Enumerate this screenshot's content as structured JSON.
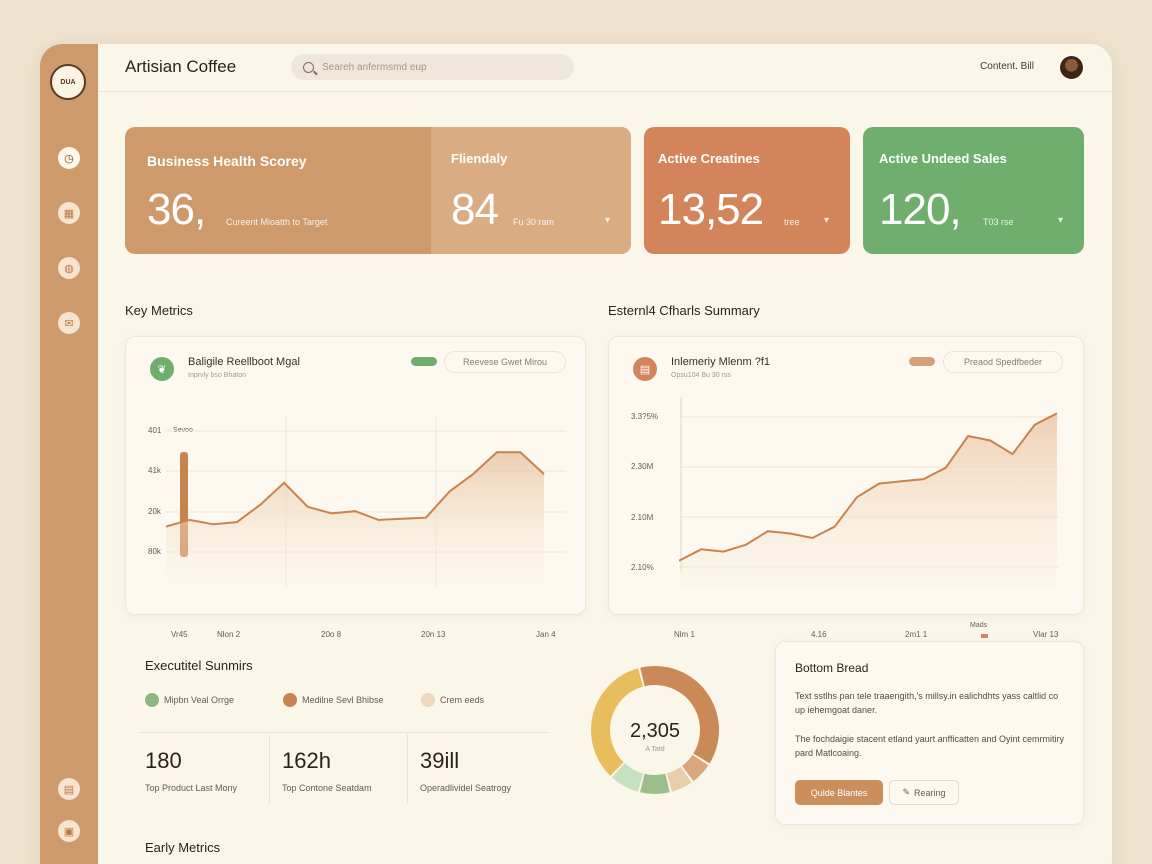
{
  "app": {
    "brand": "Artisian Coffee",
    "logo_text": "DUA",
    "search_placeholder": "Seareh anfermsmd eup",
    "user_name": "Content. Bill"
  },
  "colors": {
    "sidebar": "#cf9a6b",
    "kpi_brown": "#cf9a6b",
    "kpi_orange": "#d4845a",
    "kpi_green": "#6fae6c",
    "chart_line": "#c9834f"
  },
  "sidebar": {
    "icons": [
      "compass-icon",
      "store-icon",
      "cup-icon",
      "mail-icon",
      "calendar-icon",
      "image-icon"
    ]
  },
  "kpis": [
    {
      "title": "Business Health Scorey",
      "value": "36,",
      "sub": "Cureent Mioatth to Target"
    },
    {
      "title": "Fliendaly",
      "value": "84",
      "sub": "Fu 30 ram",
      "arrow": "▾"
    },
    {
      "title": "Active Creatines",
      "value": "13,52",
      "sub": "tree",
      "arrow": "▾"
    },
    {
      "title": "Active Undeed Sales",
      "value": "120,",
      "sub": "T03 rse",
      "arrow": "▾"
    }
  ],
  "sections": {
    "key_metrics": "Key Metrics",
    "external_summary": "Esternl4 Cfharls Summary",
    "executive": "Executitel Sunmirs",
    "bottom": "Bottom Bread",
    "early": "Early Metrics"
  },
  "chart_left": {
    "title": "Baligile Reellboot Mgal",
    "subtitle": "Inprvly bso Bhaton",
    "legend": "Reevese Gwet Mirou",
    "y_ticks": [
      "401",
      "41k",
      "20k",
      "80k"
    ],
    "series_label": "Sevoo",
    "x_ticks": [
      "Vr45",
      "Nlon 2",
      "20o 8",
      "20n 13",
      "Jan 4"
    ]
  },
  "chart_right": {
    "title": "Inlemeriy Mlenm ?f1",
    "subtitle": "Opsu104 Bu 30 rss",
    "legend": "Preaod Spedfbeder",
    "y_ticks": [
      "3.3?5%",
      "2.30M",
      "2.10M",
      "2.10%"
    ],
    "x_ticks": [
      "Nlm 1",
      "4.16",
      "2m1 1",
      "Vlar 13"
    ],
    "marker_label": "Mads"
  },
  "chart_data": [
    {
      "type": "area",
      "x": [
        "Vr45",
        "Nlon 2",
        "20o 8",
        "20n 13",
        "Jan 4"
      ],
      "series": [
        {
          "name": "Sevoo",
          "values": [
            14,
            17,
            15,
            16,
            24,
            34,
            23,
            20,
            21,
            17,
            17.5,
            18,
            30,
            38,
            48,
            48,
            38
          ]
        }
      ]
    },
    {
      "type": "area",
      "x": [
        "Nlm 1",
        "4.16",
        "2m1 1",
        "Vlar 13"
      ],
      "series": [
        {
          "values": [
            5,
            10,
            9,
            12,
            18,
            17,
            15,
            20,
            33,
            39,
            40,
            41,
            46,
            60,
            58,
            52,
            65,
            70
          ]
        }
      ]
    }
  ],
  "executive": {
    "legend": [
      {
        "label": "Mipbn Veal Orrge",
        "color": "#8db780"
      },
      {
        "label": "Medilne Sevl Bhibse",
        "color": "#c9834f"
      },
      {
        "label": "Crem eeds",
        "color": "#f0d8bf"
      }
    ],
    "stats": [
      {
        "value": "180",
        "label": "Top Product Last Mony"
      },
      {
        "value": "162h",
        "label": "Top Contone Seatdam"
      },
      {
        "value": "39ill",
        "label": "Operadlividel Seatrogy"
      }
    ],
    "donut_value": "2,305",
    "donut_label": "A Tatd",
    "donut_segments": [
      {
        "value": 38,
        "color": "#c98a58"
      },
      {
        "value": 6,
        "color": "#d9a77d"
      },
      {
        "value": 6,
        "color": "#e6cfa9"
      },
      {
        "value": 8,
        "color": "#9bbf8a"
      },
      {
        "value": 8,
        "color": "#c6e0c0"
      },
      {
        "value": 34,
        "color": "#e8bd5d"
      }
    ]
  },
  "bottom": {
    "text1": "Text sstlhs pan tele traaengith,'s millsy.in ealichdhts yass caltlid co up iehemgoat daner.",
    "text2": "The fochdaigie stacent etland yaurt anfficatten and Oyint cemrmitiry pard Matlcoaing.",
    "primary_btn": "Qulde Blantes",
    "secondary_btn": "Rearing"
  }
}
